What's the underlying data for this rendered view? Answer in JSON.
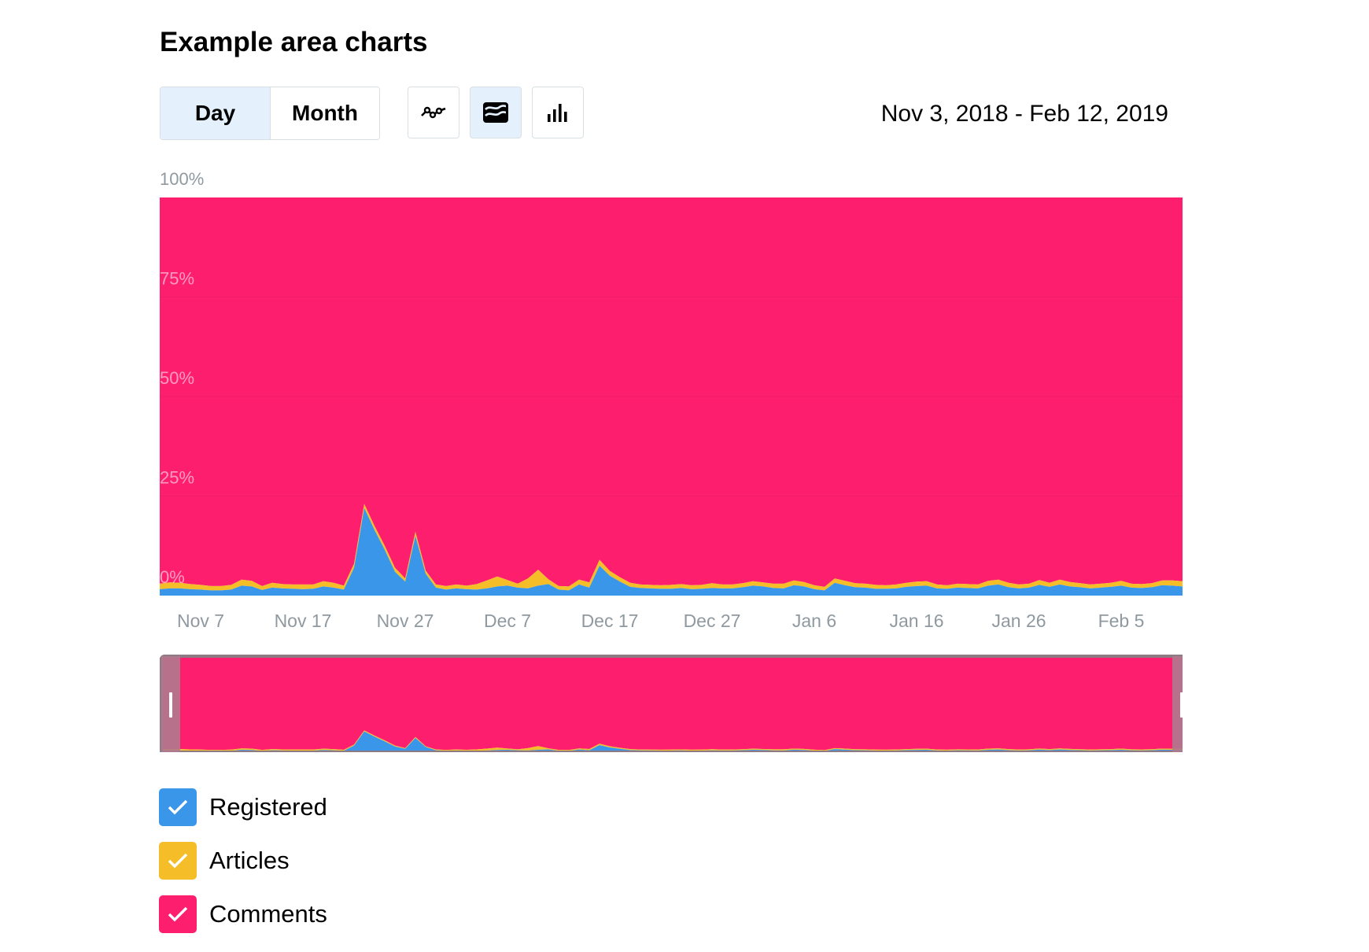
{
  "page": {
    "title": "Example area charts",
    "date_range": "Nov 3, 2018 - Feb 12, 2019"
  },
  "toolbar": {
    "period_tabs": [
      {
        "label": "Day",
        "active": true
      },
      {
        "label": "Month",
        "active": false
      }
    ],
    "chart_types": [
      {
        "name": "line-chart-icon",
        "active": false
      },
      {
        "name": "area-chart-icon",
        "active": true
      },
      {
        "name": "bar-chart-icon",
        "active": false
      }
    ]
  },
  "colors": {
    "Registered": "#3a96e8",
    "Articles": "#f5bd28",
    "Comments": "#fd1f6e"
  },
  "legend": [
    {
      "label": "Registered",
      "checked": true,
      "color": "#3a96e8"
    },
    {
      "label": "Articles",
      "checked": true,
      "color": "#f5bd28"
    },
    {
      "label": "Comments",
      "checked": true,
      "color": "#fd1f6e"
    }
  ],
  "navigator": {
    "window_start": "2018-11-03",
    "window_end": "2019-02-12"
  },
  "chart_data": {
    "type": "area",
    "stacking": "percent",
    "x_start": "2018-11-03",
    "y_tick_labels": [
      "0%",
      "25%",
      "50%",
      "75%",
      "100%"
    ],
    "x_tick_labels": [
      "Nov 7",
      "Nov 17",
      "Nov 27",
      "Dec 7",
      "Dec 17",
      "Dec 27",
      "Jan 6",
      "Jan 16",
      "Jan 26",
      "Feb 5"
    ],
    "ylim": [
      0,
      100
    ],
    "grid": true,
    "legend_position": "bottom-left",
    "series": [
      {
        "name": "Registered",
        "values": [
          1.6,
          1.8,
          1.8,
          1.6,
          1.5,
          1.3,
          1.3,
          1.5,
          2.5,
          2.3,
          1.4,
          2.0,
          1.8,
          1.7,
          1.6,
          1.7,
          2.3,
          2.0,
          1.5,
          7.0,
          22.0,
          16.5,
          11.5,
          6.0,
          3.5,
          15.0,
          5.5,
          2.0,
          1.5,
          1.8,
          1.6,
          1.5,
          1.8,
          2.3,
          2.5,
          2.0,
          1.8,
          2.5,
          2.9,
          1.5,
          1.3,
          2.8,
          2.0,
          7.5,
          5.0,
          3.5,
          2.2,
          1.9,
          1.8,
          1.7,
          1.7,
          1.9,
          1.6,
          1.7,
          1.9,
          1.8,
          1.8,
          2.1,
          2.5,
          2.3,
          1.9,
          1.8,
          2.6,
          2.3,
          1.6,
          1.3,
          3.2,
          2.6,
          2.1,
          2.0,
          1.7,
          1.7,
          1.8,
          2.2,
          2.4,
          2.5,
          1.8,
          1.7,
          2.0,
          1.9,
          1.8,
          2.5,
          2.8,
          2.1,
          1.8,
          2.0,
          2.7,
          2.2,
          2.8,
          2.3,
          2.1,
          1.8,
          2.0,
          2.2,
          2.5,
          2.0,
          1.9,
          2.1,
          2.6,
          2.5,
          2.3
        ]
      },
      {
        "name": "Articles",
        "values": [
          1.4,
          1.5,
          1.4,
          1.3,
          1.2,
          1.1,
          1.1,
          1.2,
          1.5,
          1.4,
          1.0,
          1.2,
          1.1,
          1.1,
          1.2,
          1.1,
          1.3,
          1.2,
          1.0,
          1.0,
          1.0,
          1.0,
          1.0,
          1.0,
          0.8,
          1.0,
          0.8,
          0.8,
          0.9,
          1.0,
          0.9,
          1.4,
          2.0,
          2.5,
          1.4,
          1.0,
          2.5,
          4.0,
          1.2,
          0.9,
          1.0,
          1.2,
          1.3,
          1.5,
          1.2,
          1.1,
          1.0,
          0.9,
          0.9,
          0.9,
          1.0,
          1.0,
          1.0,
          1.0,
          1.2,
          1.0,
          1.0,
          1.0,
          1.1,
          1.0,
          1.1,
          1.2,
          1.2,
          1.1,
          1.0,
          0.9,
          1.1,
          1.1,
          1.0,
          1.0,
          1.0,
          0.9,
          1.0,
          1.0,
          1.1,
          1.1,
          1.0,
          0.9,
          1.0,
          1.0,
          1.0,
          1.2,
          1.2,
          1.1,
          1.0,
          1.0,
          1.2,
          1.0,
          1.2,
          1.1,
          1.0,
          1.0,
          1.0,
          1.0,
          1.2,
          1.0,
          1.0,
          1.0,
          1.2,
          1.3,
          1.3
        ]
      },
      {
        "name": "Comments",
        "values": [
          97.0,
          96.7,
          96.8,
          97.1,
          97.3,
          97.6,
          97.6,
          97.3,
          96.0,
          96.3,
          97.6,
          96.8,
          97.1,
          97.2,
          97.2,
          97.2,
          96.4,
          96.8,
          97.5,
          92.0,
          77.0,
          82.5,
          87.5,
          93.0,
          95.7,
          84.0,
          93.7,
          97.2,
          97.6,
          97.2,
          97.5,
          97.1,
          96.2,
          95.2,
          96.1,
          97.0,
          95.7,
          93.5,
          95.9,
          97.6,
          97.7,
          96.0,
          96.7,
          91.0,
          93.8,
          95.4,
          96.8,
          97.2,
          97.3,
          97.4,
          97.3,
          97.1,
          97.4,
          97.3,
          96.9,
          97.2,
          97.2,
          96.9,
          96.4,
          96.7,
          97.0,
          97.0,
          96.2,
          96.6,
          97.4,
          97.8,
          95.7,
          96.3,
          96.9,
          97.0,
          97.3,
          97.4,
          97.2,
          96.8,
          96.5,
          96.4,
          97.2,
          97.4,
          97.0,
          97.1,
          97.2,
          96.3,
          96.0,
          96.8,
          97.2,
          97.0,
          96.1,
          96.8,
          96.0,
          96.6,
          96.9,
          97.2,
          97.0,
          96.8,
          96.3,
          97.0,
          97.1,
          96.9,
          96.2,
          96.2,
          96.4
        ]
      }
    ]
  }
}
